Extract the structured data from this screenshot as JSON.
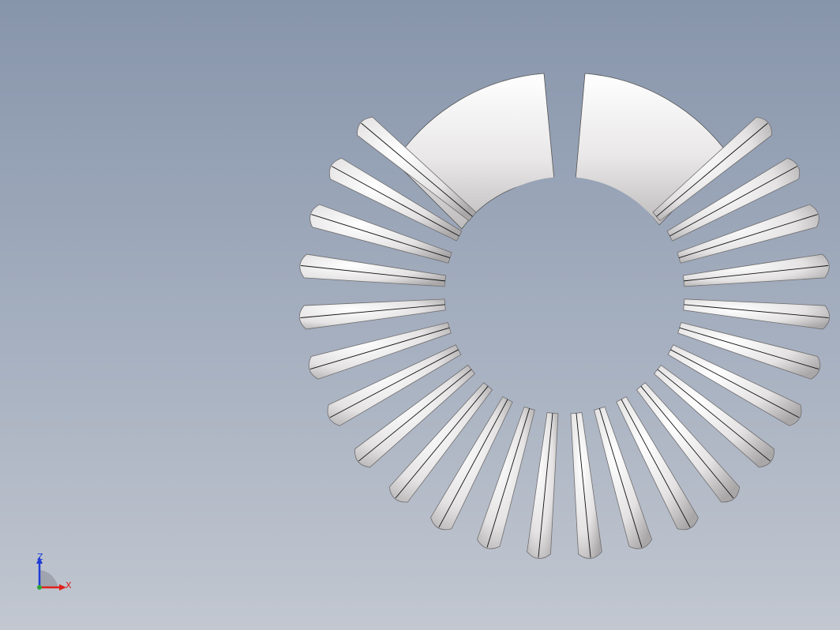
{
  "viewport": {
    "background_top": "#8795ab",
    "background_bottom": "#c2c7d0"
  },
  "model": {
    "kind": "bevel-gear-segment",
    "tooth_count_visible": 24,
    "surface_color": "#e6e4e4",
    "edge_color": "#111111"
  },
  "triad": {
    "x_label": "X",
    "z_label": "Z",
    "x_color": "#e0201a",
    "z_color": "#1f3cd6",
    "origin_color": "#2da63a"
  }
}
